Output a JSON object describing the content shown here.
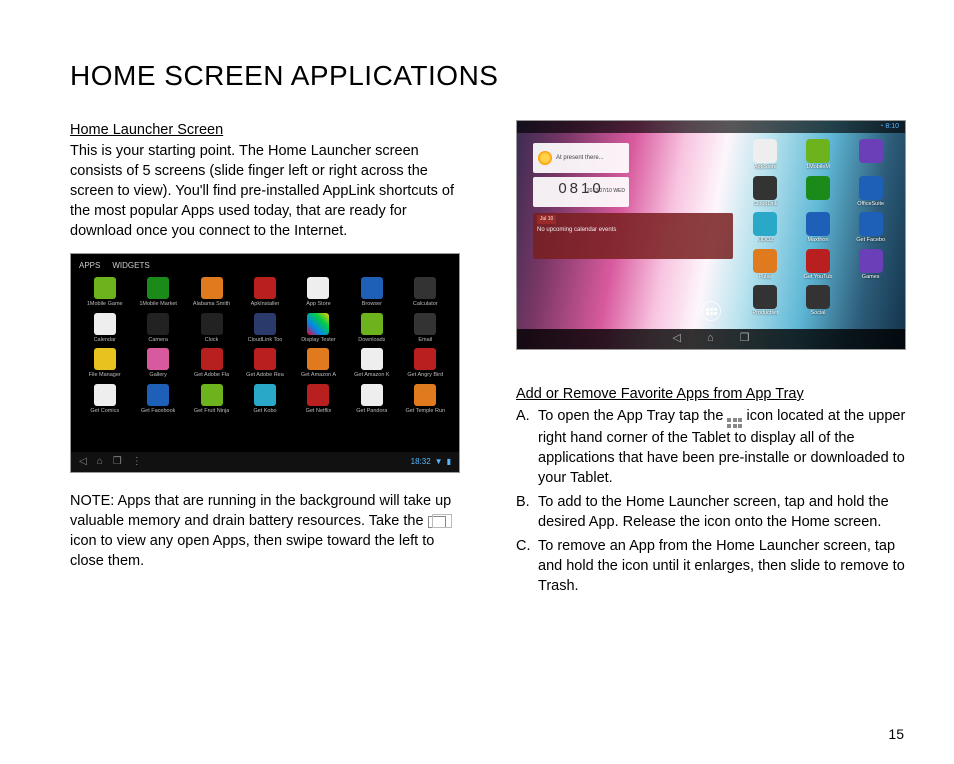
{
  "title": "HOME SCREEN APPLICATIONS",
  "page_number": "15",
  "left": {
    "heading": "Home Launcher Screen",
    "body": "This is your starting point. The Home Launcher screen consists of 5 screens (slide finger left or right across the screen to view). You'll find pre-installed AppLink shortcuts of the most popular Apps used today, that are ready for download once you connect to the Internet.",
    "note_pre": "NOTE:  Apps that are running in the background will take up valuable memory and drain battery resources. Take the ",
    "note_post": " icon to view any open Apps, then swipe toward the left to close them."
  },
  "right": {
    "heading": "Add or Remove Favorite Apps from App Tray",
    "items": [
      {
        "label": "A.",
        "pre": "To open the App Tray tap the ",
        "post": " icon located at the upper right hand corner of the Tablet to display all of the applications that have been pre-installe or downloaded to your Tablet."
      },
      {
        "label": "B.",
        "text": "To add to the Home Launcher screen, tap and hold the desired App. Release the icon onto the Home screen."
      },
      {
        "label": "C.",
        "text": "To remove an App from the Home Launcher screen, tap and hold the icon until it enlarges, then slide to remove to Trash."
      }
    ]
  },
  "shot1": {
    "tabs": [
      "APPS",
      "WIDGETS"
    ],
    "clock": "18:32",
    "apps": [
      {
        "l": "1Mobile Game",
        "c": "c-grn"
      },
      {
        "l": "1Mobile Market",
        "c": "c-grn2"
      },
      {
        "l": "Alabama Smith",
        "c": "c-org"
      },
      {
        "l": "ApkInstaller",
        "c": "c-red"
      },
      {
        "l": "App Store",
        "c": "c-wht"
      },
      {
        "l": "Browser",
        "c": "c-blu"
      },
      {
        "l": "Calculator",
        "c": "c-dgr"
      },
      {
        "l": "Calendar",
        "c": "c-wht"
      },
      {
        "l": "Camera",
        "c": "c-blk"
      },
      {
        "l": "Clock",
        "c": "c-blk"
      },
      {
        "l": "CloudLink Too",
        "c": "c-nvy"
      },
      {
        "l": "Display Tester",
        "c": "c-mul"
      },
      {
        "l": "Downloads",
        "c": "c-grn"
      },
      {
        "l": "Email",
        "c": "c-dgr"
      },
      {
        "l": "File Manager",
        "c": "c-yel"
      },
      {
        "l": "Gallery",
        "c": "c-pnk"
      },
      {
        "l": "Get Adobe Fla",
        "c": "c-red"
      },
      {
        "l": "Get Adobe Rea",
        "c": "c-red"
      },
      {
        "l": "Get Amazon A",
        "c": "c-org"
      },
      {
        "l": "Get Amazon K",
        "c": "c-wht"
      },
      {
        "l": "Get Angry Bird",
        "c": "c-red"
      },
      {
        "l": "Get Comics",
        "c": "c-wht"
      },
      {
        "l": "Get Facebook",
        "c": "c-blu"
      },
      {
        "l": "Get Fruit Ninja",
        "c": "c-grn"
      },
      {
        "l": "Get Kobo",
        "c": "c-cyn"
      },
      {
        "l": "Get Netflix",
        "c": "c-red"
      },
      {
        "l": "Get Pandora",
        "c": "c-wht"
      },
      {
        "l": "Get Temple Run",
        "c": "c-org"
      }
    ]
  },
  "shot2": {
    "status_time": "8:10",
    "weather": "At present there...",
    "clock": "0810",
    "clock_date": "2013/07/10  WED",
    "cal_hdr": "Jul 10",
    "cal_body": "No upcoming calendar events",
    "apps": [
      {
        "l": "AppStore",
        "c": "c-wht"
      },
      {
        "l": "1MobileM",
        "c": "c-grn"
      },
      {
        "l": "",
        "c": "c-pur"
      },
      {
        "l": "CloudLink",
        "c": "c-dgr"
      },
      {
        "l": "",
        "c": "c-grn2"
      },
      {
        "l": "OfficeSuite",
        "c": "c-blu"
      },
      {
        "l": "KIDOZ",
        "c": "c-cyn"
      },
      {
        "l": "Maxthon",
        "c": "c-blu"
      },
      {
        "l": "Get Facebo",
        "c": "c-blu"
      },
      {
        "l": "Pulse",
        "c": "c-org"
      },
      {
        "l": "Get YouTub",
        "c": "c-red"
      },
      {
        "l": "Games",
        "c": "c-pur"
      },
      {
        "l": "Productivit",
        "c": "c-dgr"
      },
      {
        "l": "Social",
        "c": "c-dgr"
      },
      {
        "l": "",
        "c": ""
      }
    ]
  }
}
